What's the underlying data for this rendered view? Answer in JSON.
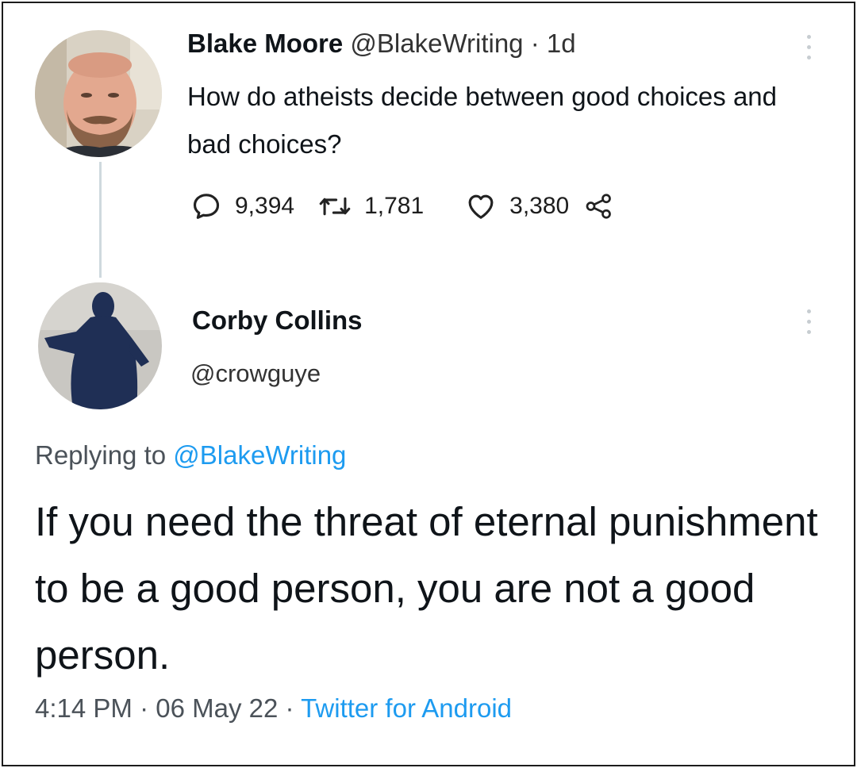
{
  "original_tweet": {
    "author_name": "Blake Moore",
    "author_handle": "@BlakeWriting",
    "time_ago": "· 1d",
    "text": "How do atheists decide between good choices and bad choices?",
    "stats": {
      "replies": "9,394",
      "retweets": "1,781",
      "likes": "3,380"
    }
  },
  "reply_tweet": {
    "author_name": "Corby Collins",
    "author_handle": "@crowguye",
    "replying_to_prefix": "Replying to",
    "replying_to_handle": "@BlakeWriting",
    "text": "If you need the threat of eternal punishment to be a good person, you are not a good person.",
    "time": "4:14 PM",
    "date": "· 06 May 22 ·",
    "source": "Twitter for Android"
  },
  "colors": {
    "accent": "#1d9bf0",
    "text_primary": "#0f1419",
    "text_secondary": "#4b5259",
    "thread_line": "#cfd9de"
  },
  "icons": {
    "reply": "comment-bubble-icon",
    "retweet": "retweet-icon",
    "like": "heart-icon",
    "share": "share-icon",
    "more": "more-vertical-icon"
  }
}
